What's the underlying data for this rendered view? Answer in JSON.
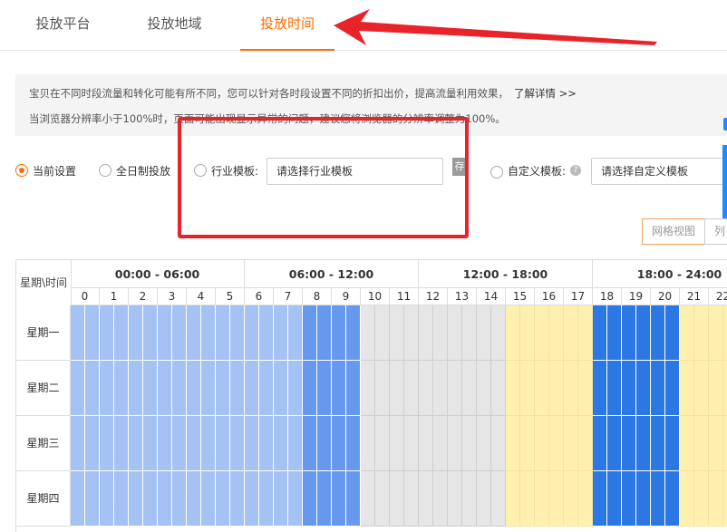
{
  "tabs": [
    {
      "label": "投放平台",
      "active": false
    },
    {
      "label": "投放地域",
      "active": false
    },
    {
      "label": "投放时间",
      "active": true
    }
  ],
  "notice": {
    "line1": "宝贝在不同时段流量和转化可能有所不同，您可以针对各时段设置不同的折扣出价，提高流量利用效果，",
    "line1_link": "了解详情 >>",
    "line2": "当浏览器分辨率小于100%时，页面可能出现显示异常的问题，建议您将浏览器的分辨率调整为100%。"
  },
  "options": {
    "current": {
      "label": "当前设置",
      "selected": true
    },
    "allday": {
      "label": "全日制投放",
      "selected": false
    },
    "industry": {
      "label": "行业模板:",
      "selected": false,
      "placeholder": "请选择行业模板",
      "save_label": "存"
    },
    "custom": {
      "label": "自定义模板:",
      "selected": false,
      "placeholder": "请选择自定义模板",
      "help": "?"
    }
  },
  "view_toggle": {
    "grid_label": "网格视图",
    "list_label": "列"
  },
  "schedule": {
    "corner_label": "星期\\时间",
    "segments": [
      "00:00 - 06:00",
      "06:00 - 12:00",
      "12:00 - 18:00",
      "18:00 - 24:00"
    ],
    "hours": [
      "0",
      "1",
      "2",
      "3",
      "4",
      "5",
      "6",
      "7",
      "8",
      "9",
      "10",
      "11",
      "12",
      "13",
      "14",
      "15",
      "16",
      "17",
      "18",
      "19",
      "20",
      "21",
      "22"
    ],
    "days": [
      "星期一",
      "星期二",
      "星期三",
      "星期四"
    ],
    "colors": {
      "light_blue": "#a4c2f4",
      "mid_blue": "#6699ee",
      "dark_blue": "#2b78e4",
      "grey": "#e6e6e6",
      "yellow": "#fff0b0"
    },
    "hour_levels": [
      "light_blue",
      "light_blue",
      "light_blue",
      "light_blue",
      "light_blue",
      "light_blue",
      "light_blue",
      "light_blue",
      "mid_blue",
      "mid_blue",
      "grey",
      "grey",
      "grey",
      "grey",
      "grey",
      "yellow",
      "yellow",
      "yellow",
      "dark_blue",
      "dark_blue",
      "dark_blue",
      "yellow",
      "yellow"
    ]
  },
  "colors": {
    "accent": "#ff6a00",
    "annotation_red": "#e8232a"
  }
}
